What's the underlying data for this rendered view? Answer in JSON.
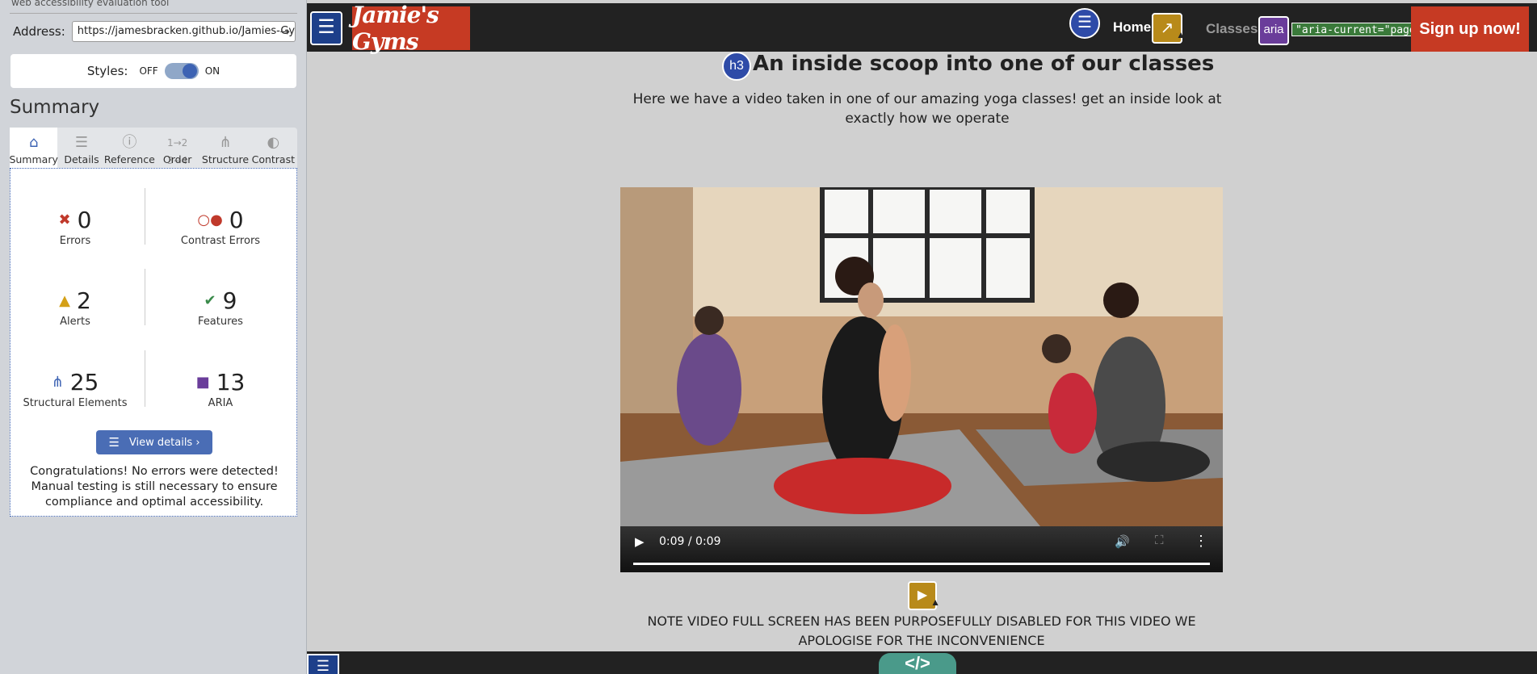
{
  "sidebar": {
    "tagline": "web accessibility evaluation tool",
    "address_label": "Address:",
    "address_value": "https://jamesbracken.github.io/Jamies-Gym",
    "address_go_icon": "arrow-right-icon",
    "styles_label": "Styles:",
    "toggle_off": "OFF",
    "toggle_on": "ON",
    "styles_state": "on",
    "summary_heading": "Summary",
    "tabs": [
      {
        "label": "Summary",
        "icon": "home-icon",
        "glyph": "⌂",
        "active": true
      },
      {
        "label": "Details",
        "icon": "list-icon",
        "glyph": "☰",
        "active": false
      },
      {
        "label": "Reference",
        "icon": "info-icon",
        "glyph": "ⓘ",
        "active": false
      },
      {
        "label": "Order",
        "icon": "order-icon",
        "glyph": "⇅",
        "active": false
      },
      {
        "label": "Structure",
        "icon": "structure-icon",
        "glyph": "⌂",
        "active": false
      },
      {
        "label": "Contrast",
        "icon": "contrast-icon",
        "glyph": "◐",
        "active": false
      }
    ],
    "stats": {
      "errors": {
        "value": "0",
        "label": "Errors",
        "icon": "error-icon",
        "color": "#c0392b"
      },
      "contrast_errors": {
        "value": "0",
        "label": "Contrast Errors",
        "icon": "contrast-error-icon",
        "color": "#c0392b"
      },
      "alerts": {
        "value": "2",
        "label": "Alerts",
        "icon": "alert-icon",
        "color": "#d4a017"
      },
      "features": {
        "value": "9",
        "label": "Features",
        "icon": "feature-icon",
        "color": "#3a8a4a"
      },
      "structural": {
        "value": "25",
        "label": "Structural Elements",
        "icon": "structure-icon",
        "color": "#3d63b3"
      },
      "aria": {
        "value": "13",
        "label": "ARIA",
        "icon": "aria-icon",
        "color": "#6a3d9a"
      }
    },
    "view_details": "View details ›",
    "congrats": "Congratulations! No errors were detected! Manual testing is still necessary to ensure compliance and optimal accessibility."
  },
  "page": {
    "nav": {
      "brand": "Jamie's Gyms",
      "home": "Home",
      "classes": "Classes",
      "aria_badge": "aria",
      "aria_current": "\"aria-current=\"page\"\"",
      "signup": "Sign up now!"
    },
    "h3_badge": "h3",
    "heading": "An inside scoop into one of our classes",
    "intro": "Here we have a video taken in one of our amazing yoga classes! get an inside look at exactly how we operate",
    "video": {
      "time": "0:09 / 0:09",
      "progress": 1.0
    },
    "note": "NOTE VIDEO FULL SCREEN HAS BEEN PURPOSEFULLY DISABLED FOR THIS VIDEO WE APOLOGISE FOR THE INCONVENIENCE",
    "code_tab": "</>"
  },
  "colors": {
    "nav_bg": "#222222",
    "brand_red": "#c63a23",
    "wave_blue": "#3d63b3",
    "alert_gold": "#b88a1a",
    "aria_purple": "#6a3d9a",
    "code_teal": "#4a9a8a"
  }
}
